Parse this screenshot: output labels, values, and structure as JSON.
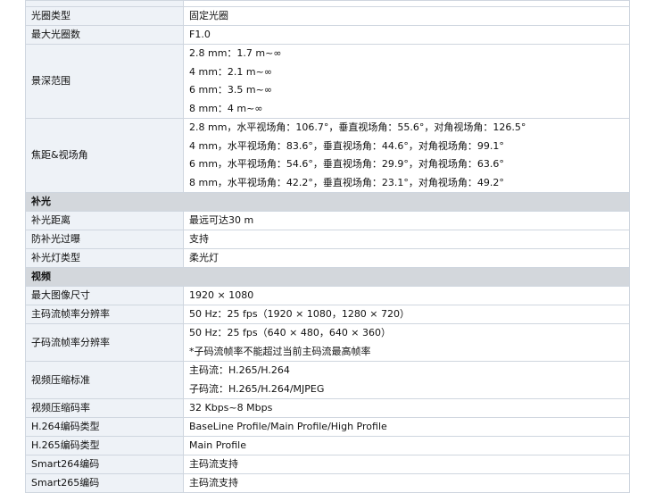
{
  "rows": [
    {
      "key": "光圈类型",
      "val": "固定光圈"
    },
    {
      "key": "最大光圈数",
      "val": "F1.0"
    },
    {
      "key": "景深范围",
      "lines": [
        "2.8 mm：1.7 m~∞",
        "4 mm：2.1 m~∞",
        "6 mm：3.5 m~∞",
        "8 mm：4 m~∞"
      ]
    },
    {
      "key": "焦距&视场角",
      "lines": [
        "2.8 mm，水平视场角：106.7°，垂直视场角：55.6°，对角视场角：126.5°",
        "4 mm，水平视场角：83.6°，垂直视场角：44.6°，对角视场角：99.1°",
        "6 mm，水平视场角：54.6°，垂直视场角：29.9°，对角视场角：63.6°",
        "8 mm，水平视场角：42.2°，垂直视场角：23.1°，对角视场角：49.2°"
      ]
    },
    {
      "section": "补光"
    },
    {
      "key": "补光距离",
      "val": "最远可达30 m"
    },
    {
      "key": "防补光过曝",
      "val": "支持"
    },
    {
      "key": "补光灯类型",
      "val": "柔光灯"
    },
    {
      "section": "视频"
    },
    {
      "key": "最大图像尺寸",
      "val": "1920 × 1080"
    },
    {
      "key": "主码流帧率分辨率",
      "val": "50 Hz：25 fps（1920 × 1080，1280 × 720）"
    },
    {
      "key": "子码流帧率分辨率",
      "lines": [
        "50 Hz：25 fps（640 × 480，640 × 360）",
        "*子码流帧率不能超过当前主码流最高帧率"
      ]
    },
    {
      "key": "视频压缩标准",
      "lines": [
        "主码流：H.265/H.264",
        "子码流：H.265/H.264/MJPEG"
      ]
    },
    {
      "key": "视频压缩码率",
      "val": "32 Kbps~8 Mbps"
    },
    {
      "key": "H.264编码类型",
      "val": "BaseLine Profile/Main Profile/High Profile"
    },
    {
      "key": "H.265编码类型",
      "val": "Main Profile"
    },
    {
      "key": "Smart264编码",
      "val": "主码流支持"
    },
    {
      "key": "Smart265编码",
      "val": "主码流支持"
    }
  ]
}
